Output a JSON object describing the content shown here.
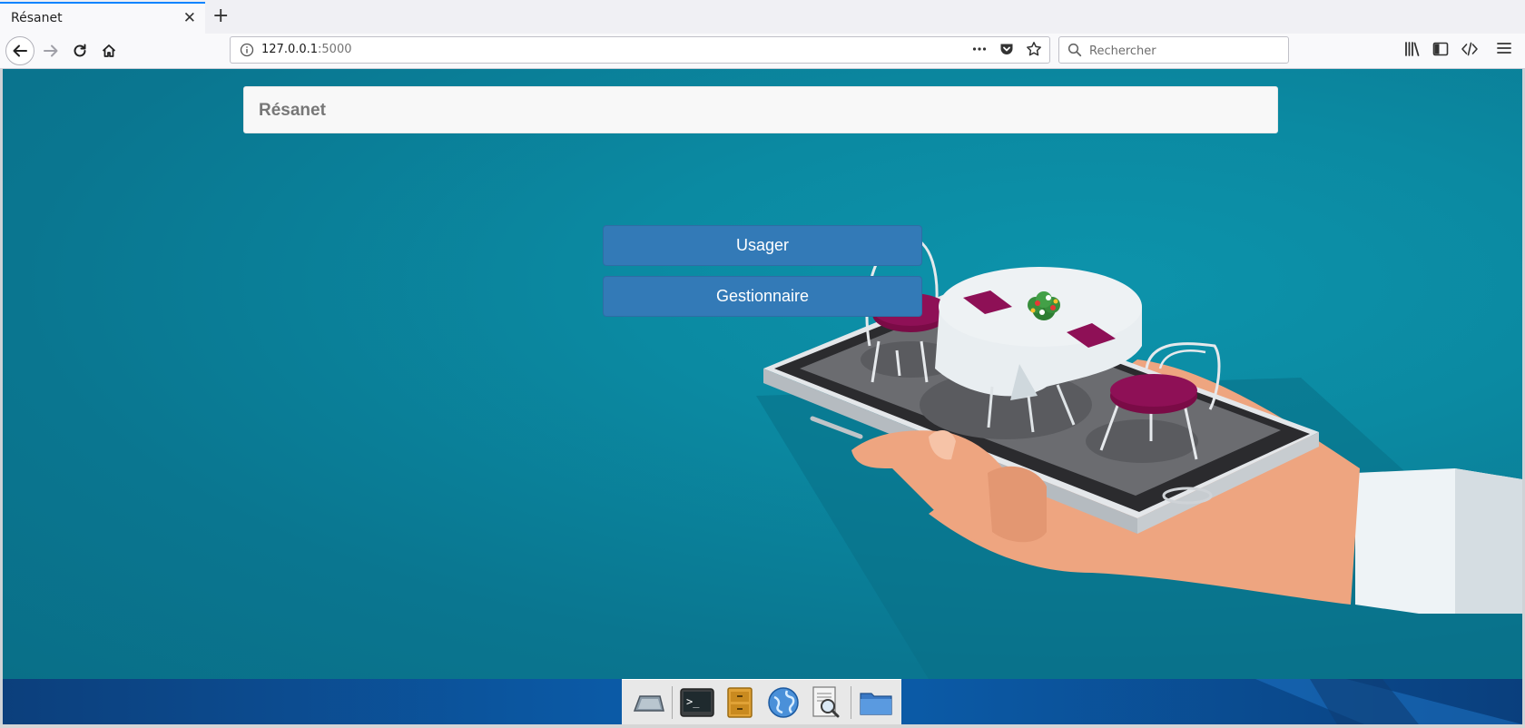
{
  "browser": {
    "tab": {
      "title": "Résanet",
      "close": "✕"
    },
    "new_tab": "+",
    "url": {
      "host": "127.0.0.1",
      "port": ":5000"
    },
    "search": {
      "placeholder": "Rechercher"
    }
  },
  "app": {
    "brand": "Résanet",
    "buttons": {
      "usager": "Usager",
      "gestionnaire": "Gestionnaire"
    }
  },
  "taskbar": {
    "items": [
      "desktop-icon",
      "terminal-icon",
      "file-cabinet-icon",
      "web-browser-icon",
      "document-viewer-icon",
      "folder-icon"
    ]
  },
  "colors": {
    "background": "#0b8aa2",
    "button": "#337ab7",
    "header": "#f8f8f8",
    "chair_seat": "#8a0d4f"
  }
}
